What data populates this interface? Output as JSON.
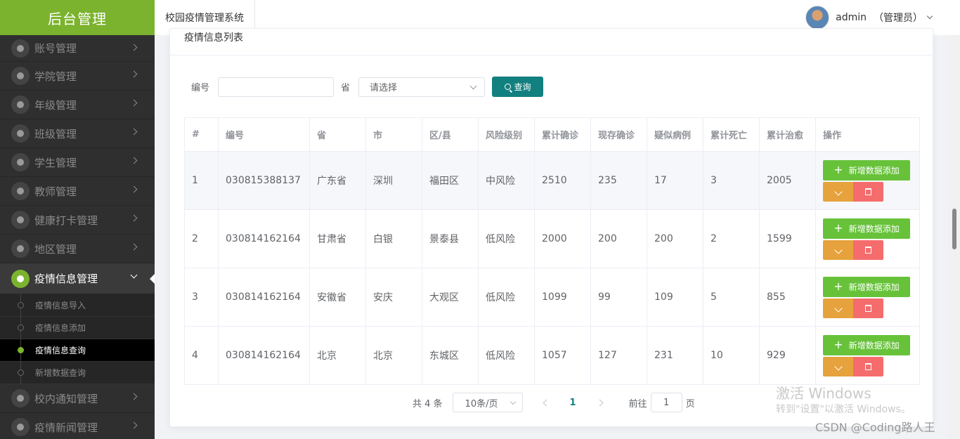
{
  "sidebar": {
    "brand": "后台管理",
    "items": [
      {
        "label": "账号管理"
      },
      {
        "label": "学院管理"
      },
      {
        "label": "年级管理"
      },
      {
        "label": "班级管理"
      },
      {
        "label": "学生管理"
      },
      {
        "label": "教师管理"
      },
      {
        "label": "健康打卡管理"
      },
      {
        "label": "地区管理"
      },
      {
        "label": "疫情信息管理"
      },
      {
        "label": "校内通知管理"
      },
      {
        "label": "疫情新闻管理"
      }
    ],
    "subitems": [
      {
        "label": "疫情信息导入"
      },
      {
        "label": "疫情信息添加"
      },
      {
        "label": "疫情信息查询"
      },
      {
        "label": "新增数据查询"
      }
    ]
  },
  "header": {
    "system_title": "校园疫情管理系统",
    "username": "admin",
    "role": "（管理员）"
  },
  "card": {
    "title": "疫情信息列表"
  },
  "search": {
    "code_label": "编号",
    "province_label": "省",
    "province_placeholder": "请选择",
    "query_label": "查询"
  },
  "table": {
    "headers": [
      "#",
      "编号",
      "省",
      "市",
      "区/县",
      "风险级别",
      "累计确诊",
      "现存确诊",
      "疑似病例",
      "累计死亡",
      "累计治愈",
      "操作"
    ],
    "rows": [
      [
        "1",
        "030815388137",
        "广东省",
        "深圳",
        "福田区",
        "中风险",
        "2510",
        "235",
        "17",
        "3",
        "2005"
      ],
      [
        "2",
        "030814162164",
        "甘肃省",
        "白银",
        "景泰县",
        "低风险",
        "2000",
        "200",
        "200",
        "2",
        "1599"
      ],
      [
        "3",
        "030814162164",
        "安徽省",
        "安庆",
        "大观区",
        "低风险",
        "1099",
        "99",
        "109",
        "5",
        "855"
      ],
      [
        "4",
        "030814162164",
        "北京",
        "北京",
        "东城区",
        "低风险",
        "1057",
        "127",
        "231",
        "10",
        "929"
      ]
    ],
    "add_label": "新增数据添加"
  },
  "pagination": {
    "total": "共 4 条",
    "page_size": "10条/页",
    "current_page": "1",
    "goto_label": "前往",
    "goto_value": "1",
    "page_unit": "页"
  },
  "watermark": {
    "line1": "激活 Windows",
    "line2": "转到\"设置\"以激活 Windows。",
    "credit": "CSDN @Coding路人王"
  }
}
